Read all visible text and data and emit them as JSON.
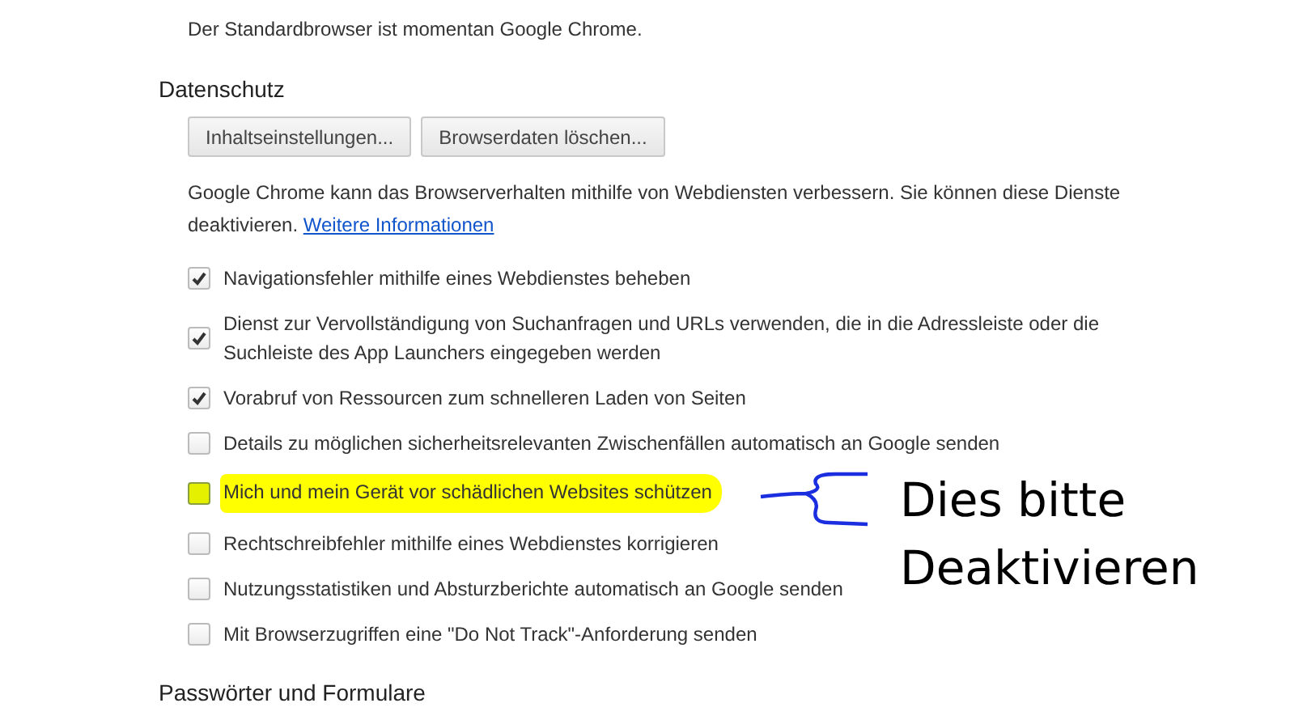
{
  "default_browser_text": "Der Standardbrowser ist momentan Google Chrome.",
  "section": {
    "title": "Datenschutz",
    "buttons": [
      "Inhaltseinstellungen...",
      "Browserdaten löschen..."
    ],
    "description": "Google Chrome kann das Browserverhalten mithilfe von Webdiensten verbessern. Sie können diese Dienste deaktivieren.",
    "link": "Weitere Informationen",
    "options": [
      {
        "label": "Navigationsfehler mithilfe eines Webdienstes beheben",
        "checked": true,
        "highlighted": false
      },
      {
        "label": "Dienst zur Vervollständigung von Suchanfragen und URLs verwenden, die in die Adressleiste oder die Suchleiste des App Launchers eingegeben werden",
        "checked": true,
        "highlighted": false
      },
      {
        "label": "Vorabruf von Ressourcen zum schnelleren Laden von Seiten",
        "checked": true,
        "highlighted": false
      },
      {
        "label": "Details zu möglichen sicherheitsrelevanten Zwischenfällen automatisch an Google senden",
        "checked": false,
        "highlighted": false
      },
      {
        "label": "Mich und mein Gerät vor schädlichen Websites schützen",
        "checked": false,
        "highlighted": true
      },
      {
        "label": "Rechtschreibfehler mithilfe eines Webdienstes korrigieren",
        "checked": false,
        "highlighted": false
      },
      {
        "label": "Nutzungsstatistiken und Absturzberichte automatisch an Google senden",
        "checked": false,
        "highlighted": false
      },
      {
        "label": "Mit Browserzugriffen eine \"Do Not Track\"-Anforderung senden",
        "checked": false,
        "highlighted": false
      }
    ]
  },
  "next_section_title": "Passwörter und Formulare",
  "annotation": {
    "lines": [
      "Dies bitte",
      "Deaktivieren"
    ]
  }
}
